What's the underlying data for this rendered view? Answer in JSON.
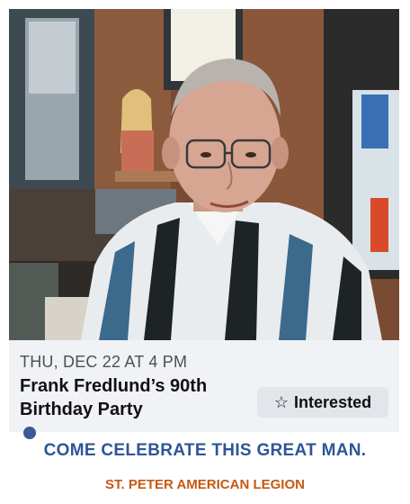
{
  "event": {
    "date_line": "THU, DEC 22 AT 4 PM",
    "title_line1": "Frank Fredlund’s 90th",
    "title_line2": "Birthday Party",
    "interested_label": "Interested",
    "interested_icon": "star-outline-icon"
  },
  "caption": {
    "tagline": "COME CELEBRATE THIS GREAT MAN.",
    "venue": "ST. PETER AMERICAN LEGION"
  },
  "colors": {
    "tagline": "#2f5597",
    "venue": "#c55a11",
    "card_background": "#f0f2f5",
    "button_background": "#e2e5ea"
  }
}
